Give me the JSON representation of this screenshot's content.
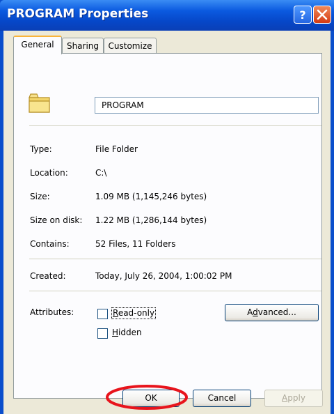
{
  "window": {
    "title": "PROGRAM Properties"
  },
  "tabs": [
    {
      "label": "General"
    },
    {
      "label": "Sharing"
    },
    {
      "label": "Customize"
    }
  ],
  "folder": {
    "name": "PROGRAM",
    "icon": "folder-icon"
  },
  "properties": [
    {
      "label": "Type:",
      "value": "File Folder"
    },
    {
      "label": "Location:",
      "value": "C:\\"
    },
    {
      "label": "Size:",
      "value": "1.09 MB (1,145,246 bytes)"
    },
    {
      "label": "Size on disk:",
      "value": "1.22 MB (1,286,144 bytes)"
    },
    {
      "label": "Contains:",
      "value": "52 Files, 11 Folders"
    }
  ],
  "created": {
    "label": "Created:",
    "value": "Today, July 26, 2004, 1:00:02 PM"
  },
  "attributes": {
    "label": "Attributes:",
    "readonly": {
      "label_first": "R",
      "label_rest": "ead-only",
      "checked": false
    },
    "hidden": {
      "label_first": "H",
      "label_rest": "idden",
      "checked": false
    },
    "advanced": {
      "label_first": "A",
      "label_underline": "d",
      "label_rest": "vanced..."
    }
  },
  "buttons": {
    "ok": "OK",
    "cancel": "Cancel",
    "apply_first": "A",
    "apply_rest": "pply"
  },
  "colors": {
    "titlebar": "#0b5ae0",
    "dialog_bg": "#ece9d8",
    "annotation_circle": "#e8141c"
  }
}
